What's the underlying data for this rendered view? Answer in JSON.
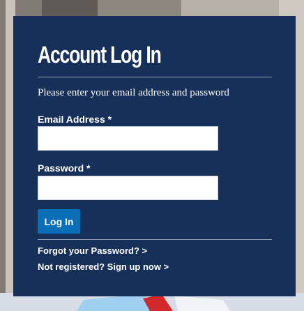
{
  "login": {
    "title": "Account Log In",
    "intro": "Please enter your email address and password",
    "email_label": "Email Address *",
    "email_value": "",
    "password_label": "Password *",
    "password_value": "",
    "submit_label": "Log In",
    "forgot_link": "Forgot your Password? >",
    "register_link": "Not registered? Sign up now >"
  },
  "colors": {
    "panel": "#16305a",
    "button": "#0b6fb7",
    "text": "#ffffff"
  }
}
